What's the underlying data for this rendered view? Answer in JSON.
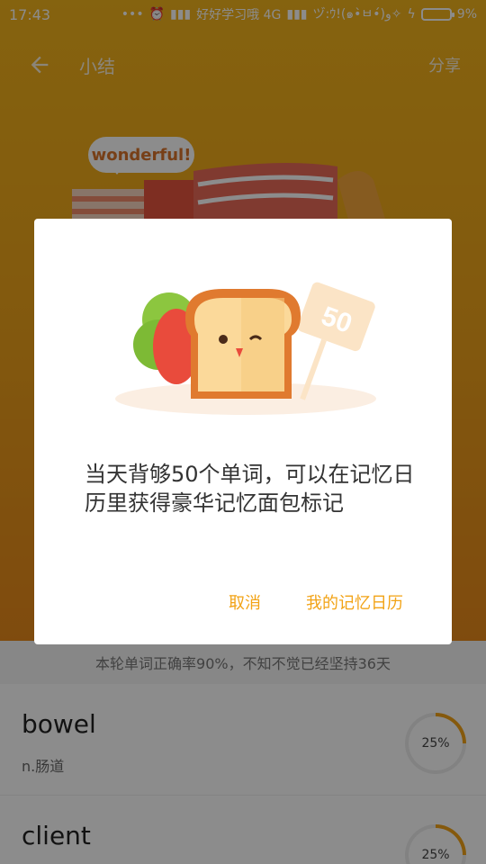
{
  "status": {
    "time": "17:43",
    "carrier": "好好学习哦 4G",
    "extra": "ヅ:ｳ!(๑•̀ㅂ•́)و✧",
    "battery": "9%"
  },
  "appbar": {
    "title": "小结",
    "share": "分享"
  },
  "hero": {
    "bubble": "wonderful!"
  },
  "dialog": {
    "message": "当天背够50个单词，可以在记忆日历里获得豪华记忆面包标记",
    "badge": "50",
    "cancel": "取消",
    "confirm": "我的记忆日历"
  },
  "list": {
    "summary": "本轮单词正确率90%，不知不觉已经坚持36天",
    "items": [
      {
        "word": "bowel",
        "definition": "n.肠道",
        "progress": "25%"
      },
      {
        "word": "client",
        "definition": "",
        "progress": "25%"
      }
    ]
  },
  "colors": {
    "accent": "#f2a316",
    "hero_top": "#f3b41c",
    "hero_bottom": "#e8891a"
  }
}
